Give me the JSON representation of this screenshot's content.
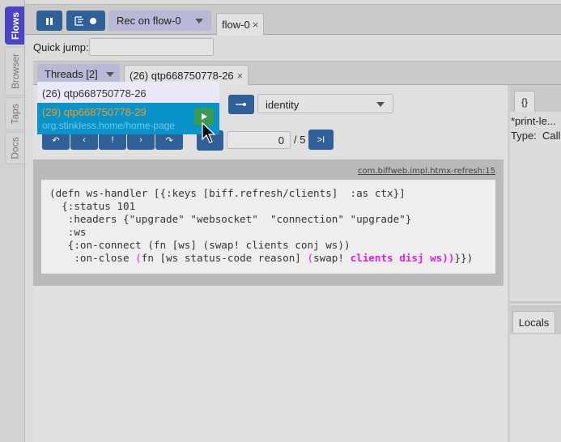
{
  "side_tabs": [
    {
      "label": "Flows",
      "active": true
    },
    {
      "label": "Browser",
      "active": false
    },
    {
      "label": "Taps",
      "active": false
    },
    {
      "label": "Docs",
      "active": false
    }
  ],
  "toolbar": {
    "pause_icon": "pause-icon",
    "record_icon": "record-tree-icon",
    "rec_select": "Rec on flow-0"
  },
  "flow_tabs": [
    {
      "label": "flow-0",
      "close": "×"
    }
  ],
  "quick_jump": {
    "label": "Quick jump:",
    "value": ""
  },
  "threads": {
    "button_label": "Threads [2]",
    "tab_label": "(26) qtp668750778-26",
    "tab_close": "×",
    "dropdown": [
      {
        "title": "(26) qtp668750778-26",
        "subtitle": ""
      },
      {
        "title": "(29) qtp668750778-29",
        "subtitle": "org.stinkless.home/home-page",
        "selected": true
      }
    ]
  },
  "controls": {
    "fn_select": "identity",
    "step_value": "0",
    "step_total": "/ 5",
    "last_btn": ">I",
    "nav_buttons": [
      "undo-step",
      "prev",
      "up",
      "next",
      "redo-step"
    ]
  },
  "code": {
    "location": "com.biffweb.impl.htmx-refresh:15",
    "lines": [
      "(defn ws-handler [{:keys [biff.refresh/clients]  :as ctx}]",
      "  {:status 101",
      "   :headers {\"upgrade\" \"websocket\"  \"connection\" \"upgrade\"}",
      "   :ws",
      "   {:on-connect (fn [ws] (swap! clients conj ws))"
    ],
    "last_line": {
      "pre": "    :on-close ",
      "p1": "(",
      "mid": "fn [ws status-code reason] ",
      "p2": "(",
      "mid2": "swap! ",
      "bold": "clients disj ws))",
      "post": "}})"
    }
  },
  "right_panel": {
    "tab_label": "{}",
    "name": "*print-le...",
    "type_label": "Type:",
    "type_value": "Call",
    "locals_tab": "Locals"
  }
}
